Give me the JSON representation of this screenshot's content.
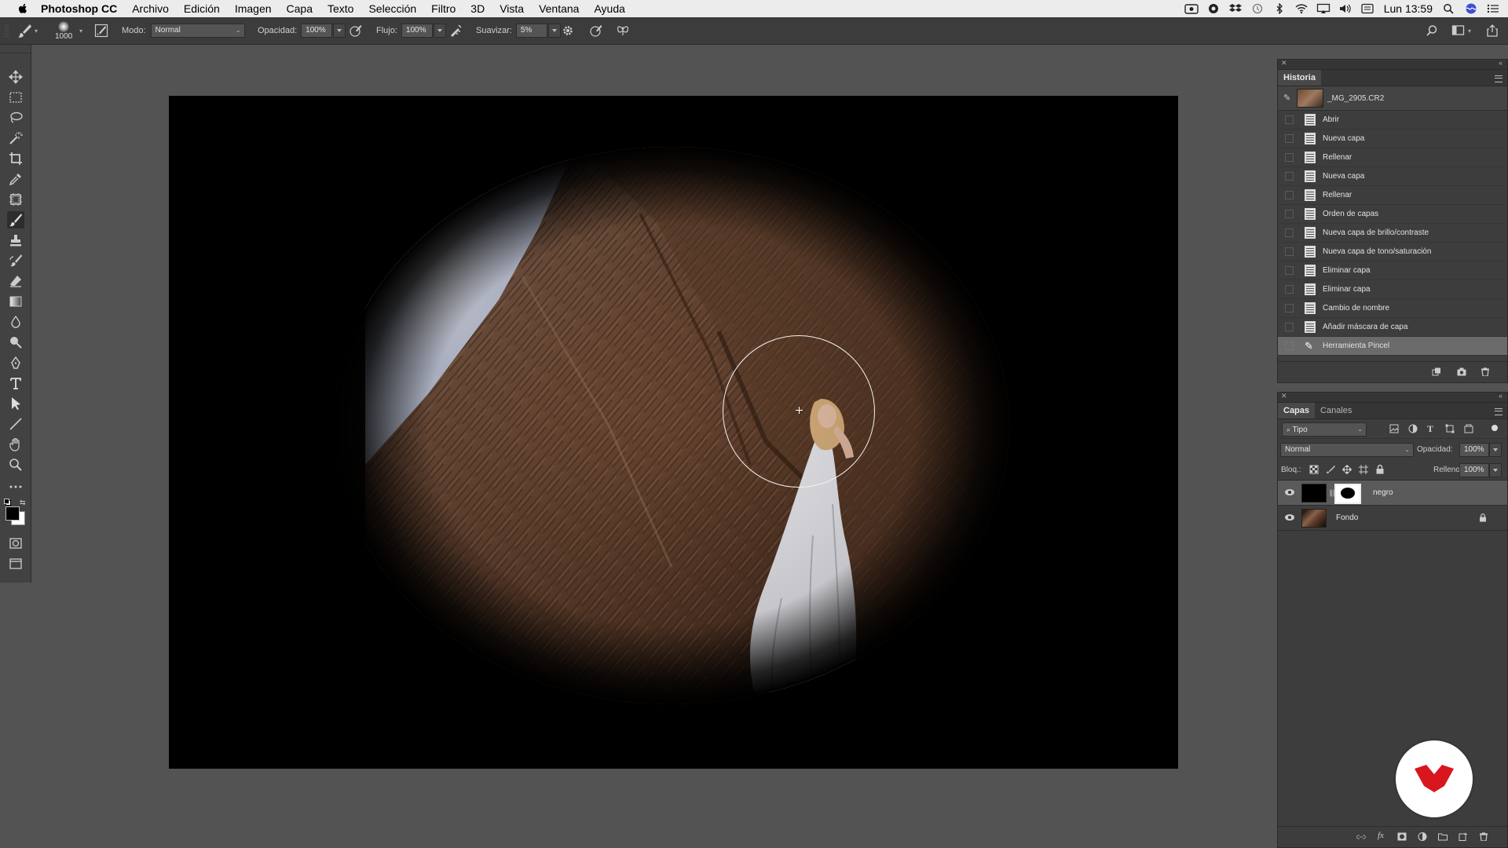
{
  "menubar": {
    "app_name": "Photoshop CC",
    "items": [
      "Archivo",
      "Edición",
      "Imagen",
      "Capa",
      "Texto",
      "Selección",
      "Filtro",
      "3D",
      "Vista",
      "Ventana",
      "Ayuda"
    ],
    "clock": "Lun 13:59"
  },
  "options": {
    "brush_size": "1000",
    "mode_label": "Modo:",
    "mode_value": "Normal",
    "opacity_label": "Opacidad:",
    "opacity_value": "100%",
    "flow_label": "Flujo:",
    "flow_value": "100%",
    "smooth_label": "Suavizar:",
    "smooth_value": "5%"
  },
  "history": {
    "tab": "Historia",
    "snapshot_name": "_MG_2905.CR2",
    "items": [
      "Abrir",
      "Nueva capa",
      "Rellenar",
      "Nueva capa",
      "Rellenar",
      "Orden de capas",
      "Nueva capa de brillo/contraste",
      "Nueva capa de tono/saturación",
      "Eliminar capa",
      "Eliminar capa",
      "Cambio de nombre",
      "Añadir máscara de capa"
    ],
    "current_item": "Herramienta Pincel"
  },
  "layers": {
    "tab_layers": "Capas",
    "tab_channels": "Canales",
    "filter_value": "Tipo",
    "blend_mode": "Normal",
    "opacity_label": "Opacidad:",
    "opacity_value": "100%",
    "lock_label": "Bloq.:",
    "fill_label": "Relleno:",
    "fill_value": "100%",
    "items": [
      {
        "name": "negro"
      },
      {
        "name": "Fondo"
      }
    ]
  },
  "colors": {
    "accent_logo": "#d9161d",
    "history_selected": "#6b6b6b",
    "layer_selected": "#5a5a5a"
  }
}
